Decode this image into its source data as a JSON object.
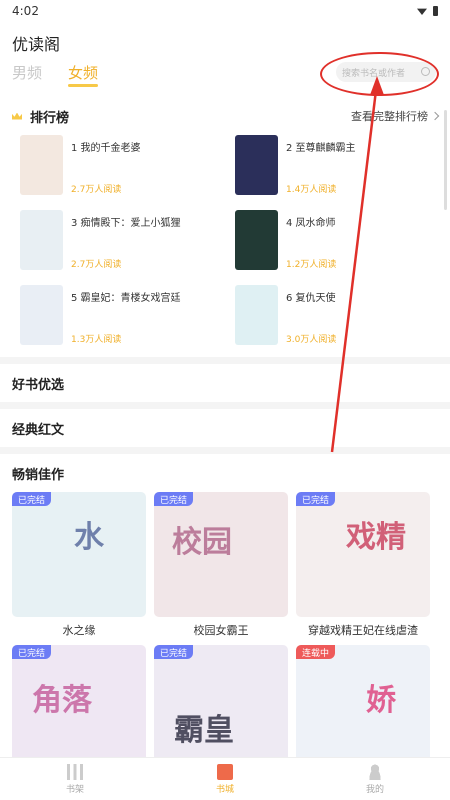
{
  "status": {
    "time": "4:02"
  },
  "app": {
    "title": "优读阁"
  },
  "gender_tabs": [
    {
      "label": "男频"
    },
    {
      "label": "女频"
    }
  ],
  "search": {
    "placeholder": "搜索书名或作者"
  },
  "ranking": {
    "title": "排行榜",
    "more": "查看完整排行榜",
    "items": [
      {
        "name": "1 我的千金老婆",
        "reads": "2.7万人阅读",
        "cover_color": "#f3e8e0"
      },
      {
        "name": "2 至尊麒麟霸主",
        "reads": "1.4万人阅读",
        "cover_color": "#2b2f5a"
      },
      {
        "name": "3 痴情殿下：爱上小狐狸",
        "reads": "2.7万人阅读",
        "cover_color": "#e8eff3"
      },
      {
        "name": "4 凤水命师",
        "reads": "1.2万人阅读",
        "cover_color": "#223a35"
      },
      {
        "name": "5 霸皇妃：青楼女戏宫廷",
        "reads": "1.3万人阅读",
        "cover_color": "#e9eef5"
      },
      {
        "name": "6 复仇天使",
        "reads": "3.0万人阅读",
        "cover_color": "#dff0f3"
      }
    ]
  },
  "sections": {
    "good": "好书优选",
    "classic": "经典红文",
    "bestseller": "畅销佳作"
  },
  "bestsellers": [
    {
      "name": "水之缘",
      "badge": "已完结",
      "cover_color": "#e7f1f4",
      "art": "水"
    },
    {
      "name": "校园女霸王",
      "badge": "已完结",
      "cover_color": "#f1e6e8",
      "art": "校园"
    },
    {
      "name": "穿越戏精王妃在线虐渣",
      "badge": "已完结",
      "cover_color": "#f4eeee",
      "art": "戏精"
    },
    {
      "name": "",
      "badge": "已完结",
      "cover_color": "#efe7f3",
      "art": "角落"
    },
    {
      "name": "",
      "badge": "已完结",
      "cover_color": "#eeeaf3",
      "art": "霸皇"
    },
    {
      "name": "",
      "badge": "连载中",
      "cover_color": "#eef2f8",
      "art": "娇"
    }
  ],
  "tabbar": [
    {
      "label": "书架"
    },
    {
      "label": "书城"
    },
    {
      "label": "我的"
    }
  ],
  "colors": {
    "accent": "#f0b02a",
    "annotation": "#e0302a",
    "completed": "#6c7cf5",
    "ongoing": "#ee5a5a"
  }
}
